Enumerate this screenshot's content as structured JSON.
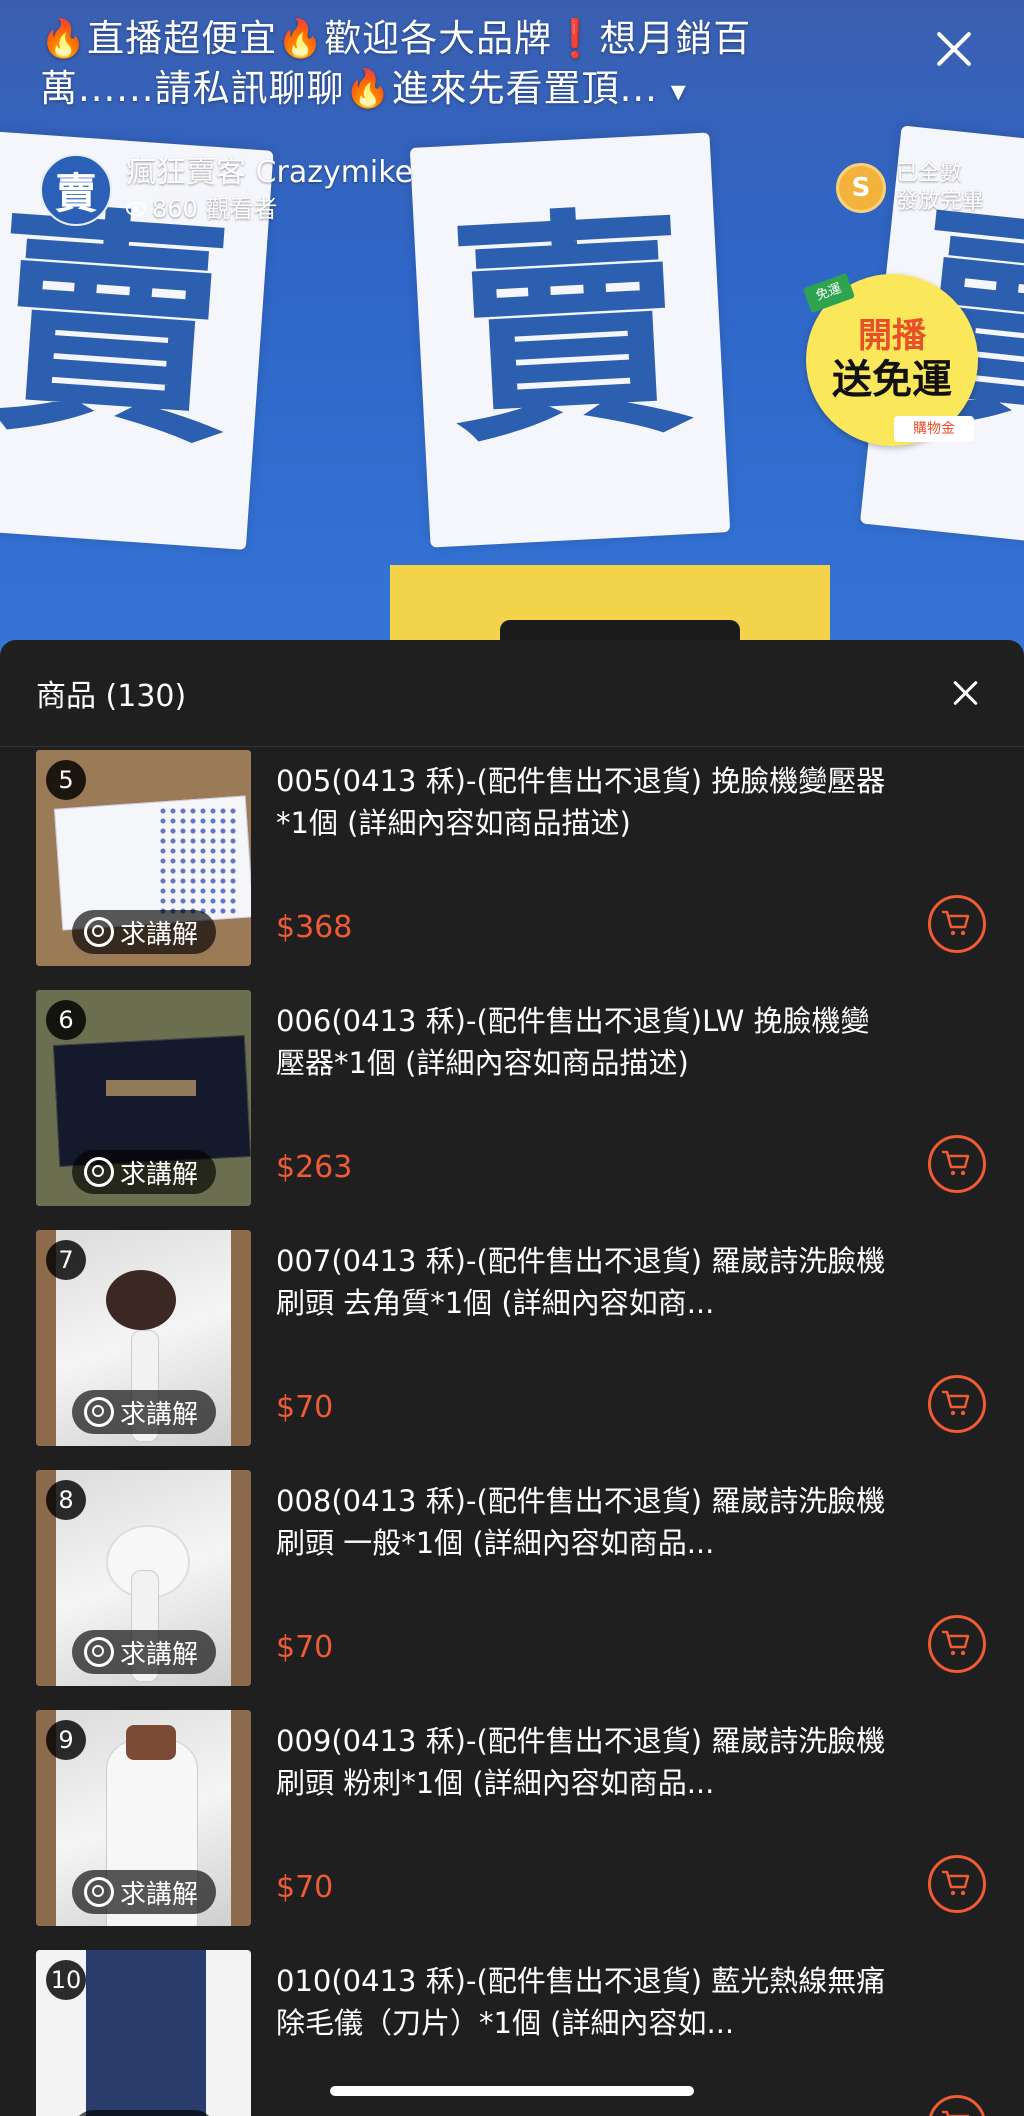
{
  "live": {
    "title": "🔥直播超便宜🔥歡迎各大品牌❗️想月銷百萬......請私訊聊聊🔥進來先看置頂...",
    "title_arrow": "▾",
    "streamer": {
      "avatar_char": "賣",
      "name": "瘋狂賣客 Crazymike",
      "viewers": "860 觀看者"
    },
    "coin": {
      "icon": "S",
      "text_line1": "已全數",
      "text_line2": "發放完畢"
    },
    "promo": {
      "line1": "開播",
      "line2": "送免運",
      "tag_top": "免運",
      "tag_bottom": "購物金"
    },
    "sign_char": "賣"
  },
  "sheet": {
    "title": "商品 (130)"
  },
  "explain_label": "求講解",
  "products": [
    {
      "num": "5",
      "title": "005(0413 秝)-(配件售出不退貨) 挽臉機變壓器*1個 (詳細內容如商品描述)",
      "price": "$368"
    },
    {
      "num": "6",
      "title": "006(0413 秝)-(配件售出不退貨)LW 挽臉機變壓器*1個 (詳細內容如商品描述)",
      "price": "$263"
    },
    {
      "num": "7",
      "title": "007(0413 秝)-(配件售出不退貨) 羅崴詩洗臉機刷頭 去角質*1個 (詳細內容如商...",
      "price": "$70"
    },
    {
      "num": "8",
      "title": "008(0413 秝)-(配件售出不退貨) 羅崴詩洗臉機刷頭 一般*1個 (詳細內容如商品...",
      "price": "$70"
    },
    {
      "num": "9",
      "title": "009(0413 秝)-(配件售出不退貨) 羅崴詩洗臉機刷頭 粉刺*1個 (詳細內容如商品...",
      "price": "$70"
    },
    {
      "num": "10",
      "title": "010(0413 秝)-(配件售出不退貨) 藍光熱線無痛除毛儀（刀片）*1個 (詳細內容如...",
      "price": ""
    }
  ],
  "colors": {
    "accent": "#ee5b34",
    "sheet_bg": "#1f1f1f",
    "brand_blue": "#2d5fb0"
  }
}
